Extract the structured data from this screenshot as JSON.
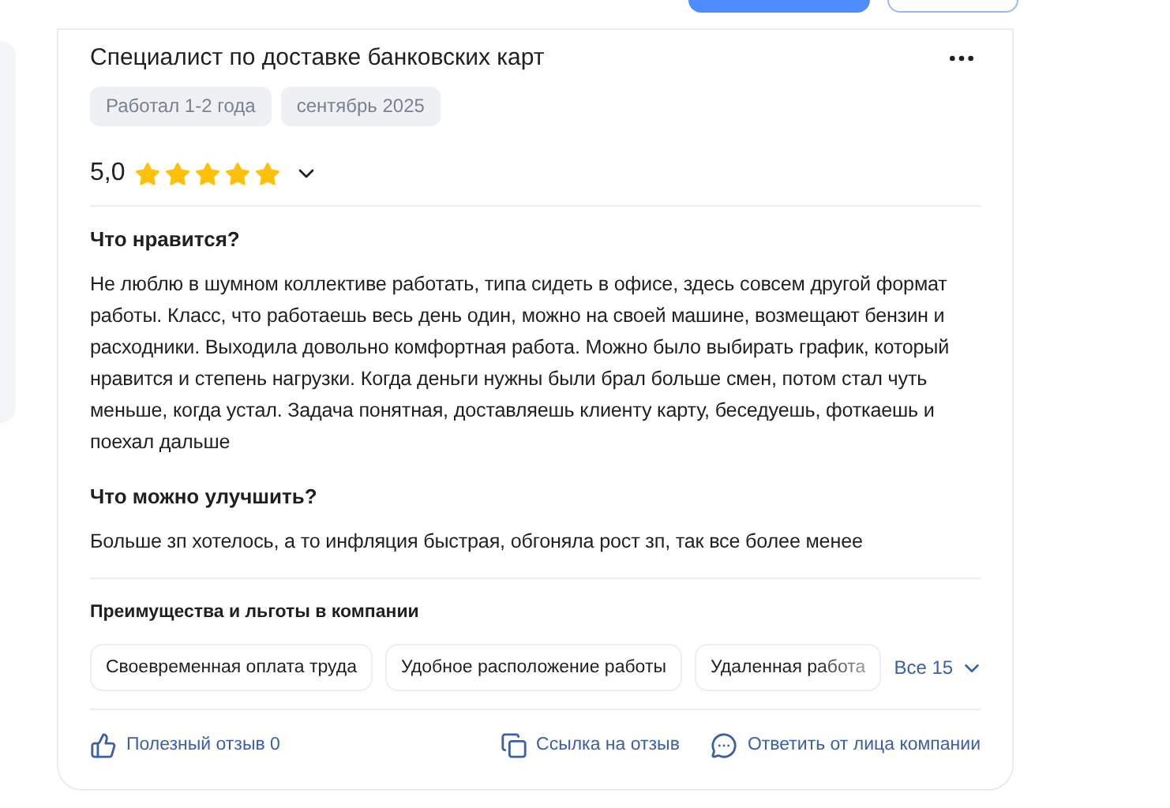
{
  "review": {
    "title": "Специалист по доставке банковских карт",
    "tags": [
      "Работал 1-2 года",
      "сентябрь 2025"
    ],
    "rating": "5,0",
    "stars": 5,
    "sections": [
      {
        "heading": "Что нравится?",
        "text": "Не люблю в шумном коллективе работать, типа сидеть в офисе, здесь совсем другой формат работы. Класс, что работаешь весь день один, можно на своей машине, возмещают бензин и расходники. Выходила довольно комфортная работа. Можно было выбирать график, который нравится и степень нагрузки. Когда деньги нужны были брал больше смен, потом стал чуть меньше, когда устал. Задача понятная, доставляешь клиенту карту, беседуешь, фоткаешь и поехал дальше"
      },
      {
        "heading": "Что можно улучшить?",
        "text": "Больше зп хотелось, а то инфляция быстрая, обгоняла рост зп, так все более менее"
      }
    ],
    "benefits": {
      "heading": "Преимущества и льготы в компании",
      "items": [
        "Своевременная оплата труда",
        "Удобное расположение работы",
        "Удаленная работа"
      ],
      "more": "Все 15"
    },
    "actions": [
      {
        "kind": "like",
        "label": "Полезный отзыв 0"
      },
      {
        "kind": "link",
        "label": "Ссылка на отзыв"
      },
      {
        "kind": "reply",
        "label": "Ответить от лица компании"
      }
    ]
  }
}
